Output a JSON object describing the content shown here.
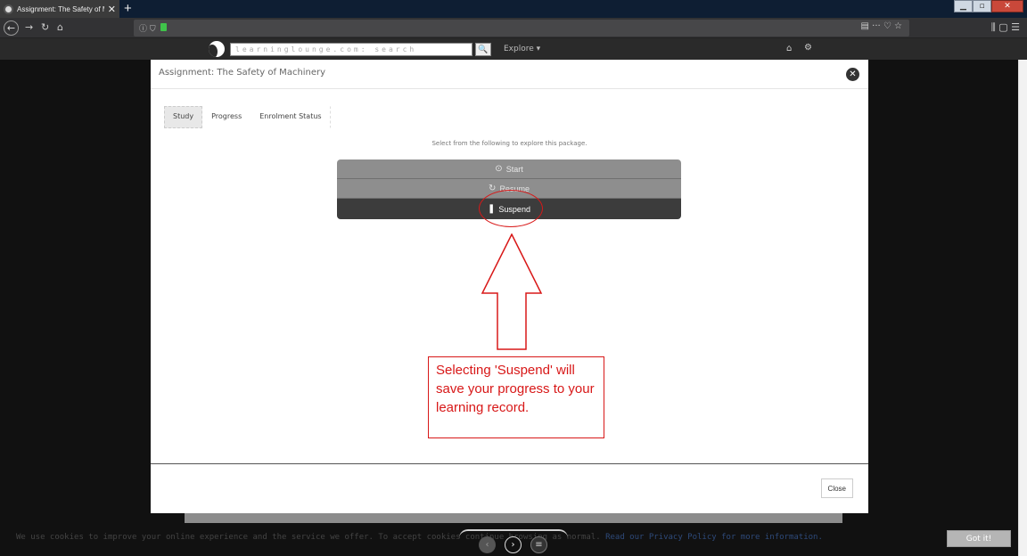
{
  "browser": {
    "tab_title": "Assignment: The Safety of Ma",
    "tab_close": "✕",
    "new_tab": "+",
    "url_info": "ⓘ ⛉",
    "urlbar_actions": "▤   ···  ♡  ☆",
    "toolbar_right": "⫼  ▢  ☰"
  },
  "site": {
    "search_placeholder": "learninglounge.com: search",
    "search_button": "🔍",
    "explore_label": "Explore ▾",
    "home_icon": "⌂",
    "gear_icon": "⚙"
  },
  "modal": {
    "title": "Assignment: The Safety of Machinery",
    "close_x": "✕",
    "tabs": [
      "Study",
      "Progress",
      "Enrolment Status"
    ],
    "instructions": "Select from the following to explore this package.",
    "menu": {
      "start": "Start",
      "resume": "Resume",
      "suspend": "Suspend"
    },
    "footer_close": "Close"
  },
  "annotation": {
    "callout": "Selecting 'Suspend' will save your progress to your learning record.",
    "color": "#d81818"
  },
  "cookie": {
    "text": "We use cookies to improve your online experience and the service we offer. To accept cookies continue browsing as normal.",
    "link": "Read our Privacy Policy for more information.",
    "button": "Got it!"
  },
  "player": {
    "prev": "‹",
    "next": "›",
    "menu": "≡"
  }
}
